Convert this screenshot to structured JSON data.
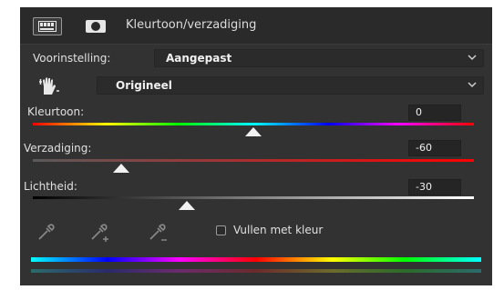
{
  "header": {
    "title": "Kleurtoon/verzadiging",
    "adjustment_icon": "hue-saturation-adjustment-icon",
    "mask_icon": "layer-mask-icon"
  },
  "preset": {
    "label": "Voorinstelling:",
    "value": "Aangepast"
  },
  "channel": {
    "value": "Origineel",
    "icon": "targeted-adjustment-hand-icon"
  },
  "hue": {
    "label": "Kleurtoon:",
    "value": "0",
    "level": 0.5
  },
  "saturation": {
    "label": "Verzadiging:",
    "value": "-60",
    "level": 0.2
  },
  "lightness": {
    "label": "Lichtheid:",
    "value": "-30",
    "level": 0.35
  },
  "tools": [
    "eyedropper-icon",
    "eyedropper-plus-icon",
    "eyedropper-minus-icon"
  ],
  "colorize": {
    "label": "Vullen met kleur",
    "checked": false
  },
  "colors": {
    "panel_bg": "#323232",
    "header_bg": "#2a2a2a",
    "field_bg": "#2b2b2b",
    "text": "#e0e0e0"
  }
}
